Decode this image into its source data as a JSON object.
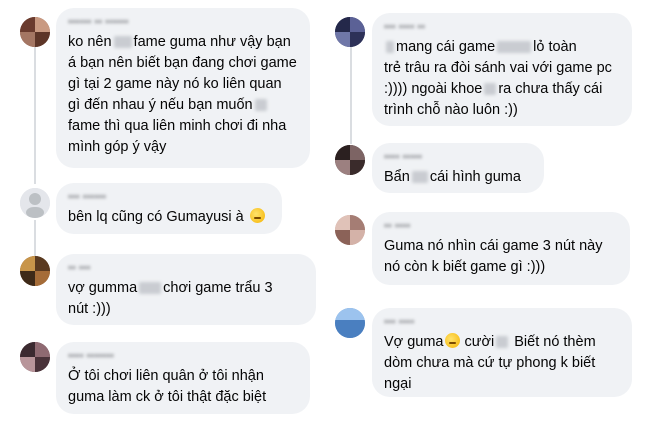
{
  "colors": {
    "bubble": "#f0f2f5",
    "text": "#050505",
    "meta": "#65676b",
    "thread": "#dadde1"
  },
  "left": [
    {
      "name": "▪▪▪▪▪▪ ▪▪ ▪▪▪▪▪▪",
      "parts": [
        "ko nên",
        "fame guma như vậy bạn\ná bạn nên biết bạn đang chơi game\ngì tại 2 game này nó ko liên quan\ngì đến nhau ý nếu bạn muốn",
        "\nfame thì qua liên minh chơi đi nha\nmình góp ý vậy"
      ],
      "avatar_icon": "avatar-icon"
    },
    {
      "name": "▪▪▪ ▪▪▪▪▪▪",
      "text": "bên lq cũng có Gumayusi à",
      "emoji_icon": "thinking-emoji-icon",
      "avatar_icon": "default-avatar-icon"
    },
    {
      "name": "▪▪ ▪▪▪",
      "parts": [
        "vợ gumma",
        "chơi game trẩu 3\nnút :)))"
      ],
      "avatar_icon": "avatar-icon"
    },
    {
      "name": "▪▪▪▪ ▪▪▪▪▪▪▪",
      "text": "Ở tôi chơi liên quân ở tôi nhận\nguma làm ck ở tôi thật đặc biệt",
      "avatar_icon": "avatar-icon"
    }
  ],
  "right": [
    {
      "name": "▪▪▪ ▪▪▪▪ ▪▪",
      "parts": [
        "mang cái game",
        "lỏ toàn\ntrẻ trâu ra đòi sánh vai với game pc\n:)))) ngoài khoe",
        "ra chưa thấy cái\ntrình chỗ nào luôn :))"
      ],
      "avatar_icon": "avatar-icon"
    },
    {
      "name": "▪▪▪▪ ▪▪▪▪▪",
      "parts": [
        "Bẩn",
        "cái hình guma"
      ],
      "avatar_icon": "avatar-icon"
    },
    {
      "name": "▪▪ ▪▪▪▪",
      "text": "Guma nó nhìn cái game 3 nút này\nnó còn k biết game gì :)))",
      "avatar_icon": "avatar-icon"
    },
    {
      "name": "▪▪▪ ▪▪▪▪",
      "parts": [
        "Vợ guma",
        "cười",
        "Biết nó thèm\ndòm chưa mà cứ tự phong k biết\nngại"
      ],
      "emoji_icon": "laughing-emoji-icon",
      "avatar_icon": "avatar-icon"
    }
  ]
}
